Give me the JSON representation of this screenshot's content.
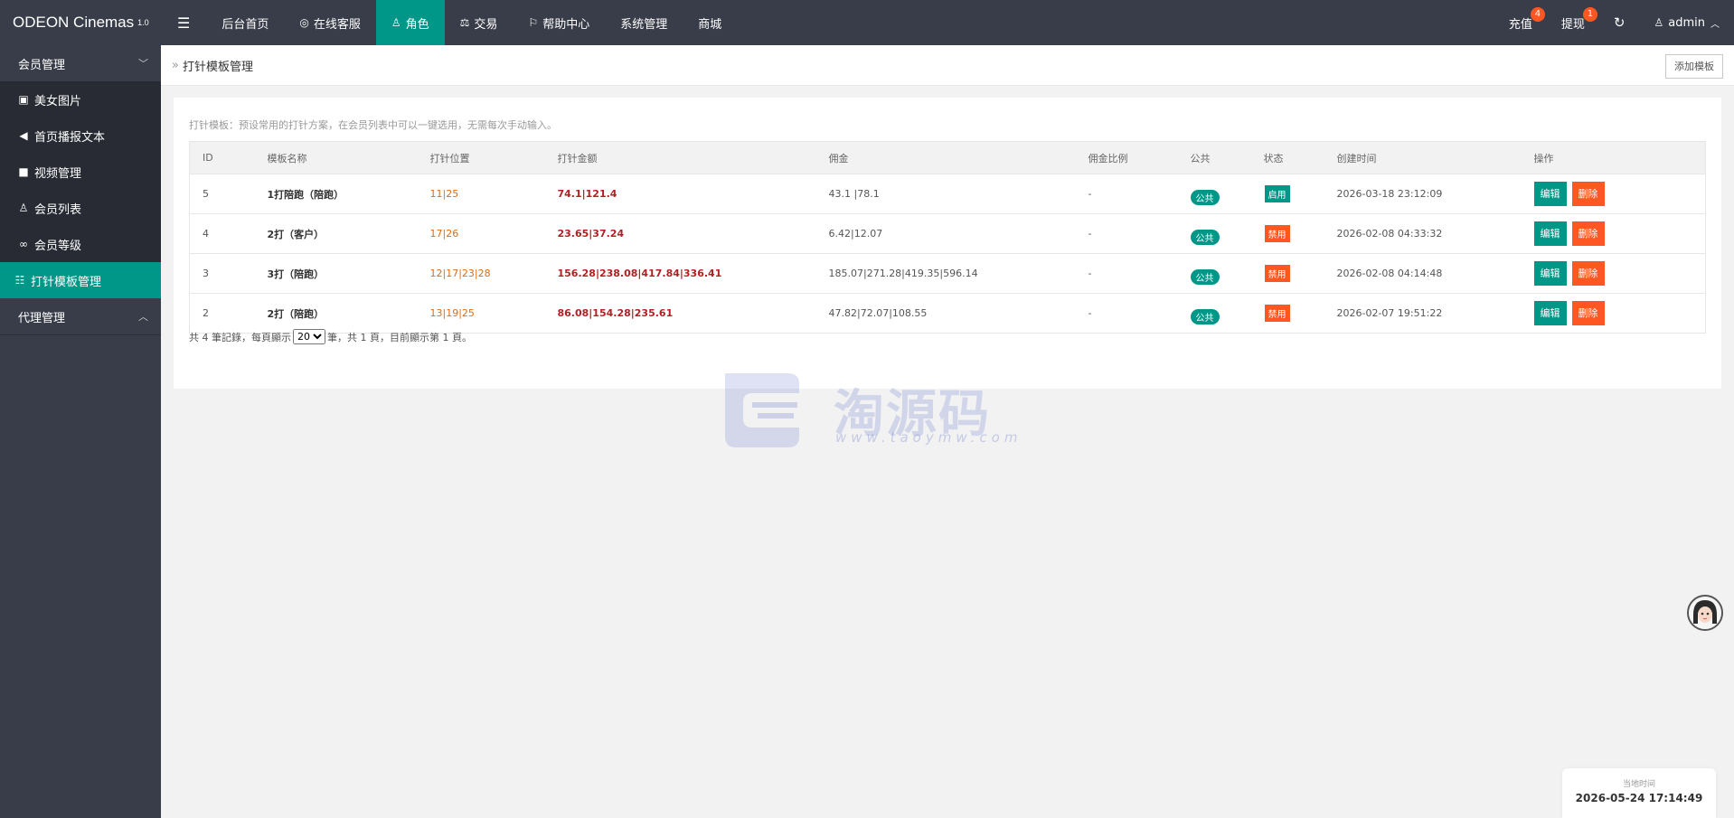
{
  "app": {
    "title": "ODEON Cinemas",
    "version": "1.0"
  },
  "topnav": {
    "menu_icon": "menu-icon",
    "items": [
      {
        "label": "后台首页",
        "icon": ""
      },
      {
        "label": "在线客服",
        "icon": "headset-icon"
      },
      {
        "label": "角色",
        "icon": "user-icon"
      },
      {
        "label": "交易",
        "icon": "scale-icon"
      },
      {
        "label": "帮助中心",
        "icon": "flag-icon"
      },
      {
        "label": "系统管理",
        "icon": ""
      },
      {
        "label": "商城",
        "icon": ""
      }
    ],
    "active_index": 2,
    "right": {
      "recharge": {
        "label": "充值",
        "badge": "4"
      },
      "withdraw": {
        "label": "提现",
        "badge": "1"
      },
      "refresh_icon": "refresh-icon",
      "user": {
        "label": "admin",
        "icon": "user-icon"
      }
    }
  },
  "sidebar": {
    "group1": {
      "label": "会员管理"
    },
    "items": [
      {
        "label": "美女图片",
        "icon": "image-icon"
      },
      {
        "label": "首页播报文本",
        "icon": "megaphone-icon"
      },
      {
        "label": "视频管理",
        "icon": "video-icon"
      },
      {
        "label": "会员列表",
        "icon": "user-icon"
      },
      {
        "label": "会员等级",
        "icon": "link-icon"
      },
      {
        "label": "打针模板管理",
        "icon": "sliders-icon"
      }
    ],
    "active_index": 5,
    "group2": {
      "label": "代理管理"
    }
  },
  "breadcrumb": {
    "icon": "double-chevron-icon",
    "text": "打针模板管理"
  },
  "toolbar": {
    "add_label": "添加模板"
  },
  "tip": "打针模板：预设常用的打针方案，在会员列表中可以一键选用，无需每次手动输入。",
  "table": {
    "headers": [
      "ID",
      "模板名称",
      "打针位置",
      "打针金额",
      "佣金",
      "佣金比例",
      "公共",
      "状态",
      "创建时间",
      "操作"
    ],
    "rows": [
      {
        "id": "5",
        "name": "1打陪跑（陪跑）",
        "pos": "11|25",
        "amount": "74.1|121.4",
        "commission": "43.1 |78.1",
        "ratio": "-",
        "public": "公共",
        "status": "启用",
        "status_on": true,
        "created": "2026-03-18 23:12:09"
      },
      {
        "id": "4",
        "name": "2打（客户）",
        "pos": "17|26",
        "amount": "23.65|37.24",
        "commission": "6.42|12.07",
        "ratio": "-",
        "public": "公共",
        "status": "禁用",
        "status_on": false,
        "created": "2026-02-08 04:33:32"
      },
      {
        "id": "3",
        "name": "3打（陪跑）",
        "pos": "12|17|23|28",
        "amount": "156.28|238.08|417.84|336.41",
        "commission": "185.07|271.28|419.35|596.14",
        "ratio": "-",
        "public": "公共",
        "status": "禁用",
        "status_on": false,
        "created": "2026-02-08 04:14:48"
      },
      {
        "id": "2",
        "name": "2打（陪跑）",
        "pos": "13|19|25",
        "amount": "86.08|154.28|235.61",
        "commission": "47.82|72.07|108.55",
        "ratio": "-",
        "public": "公共",
        "status": "禁用",
        "status_on": false,
        "created": "2026-02-07 19:51:22"
      }
    ],
    "edit_label": "编辑",
    "delete_label": "删除"
  },
  "pager": {
    "prefix": "共 4 筆記錄，每頁顯示",
    "per_page": "20",
    "suffix": "筆，共 1 頁，目前顯示第 1 頁。"
  },
  "watermark": {
    "text": "淘源码",
    "url": "www.taoymw.com"
  },
  "clock": {
    "label": "当地时间",
    "time": "2026-05-24 17:14:49"
  },
  "colors": {
    "accent": "#009688",
    "danger": "#ff5722",
    "topbar": "#393d49",
    "amount": "#b21f24",
    "position": "#e06c10"
  }
}
